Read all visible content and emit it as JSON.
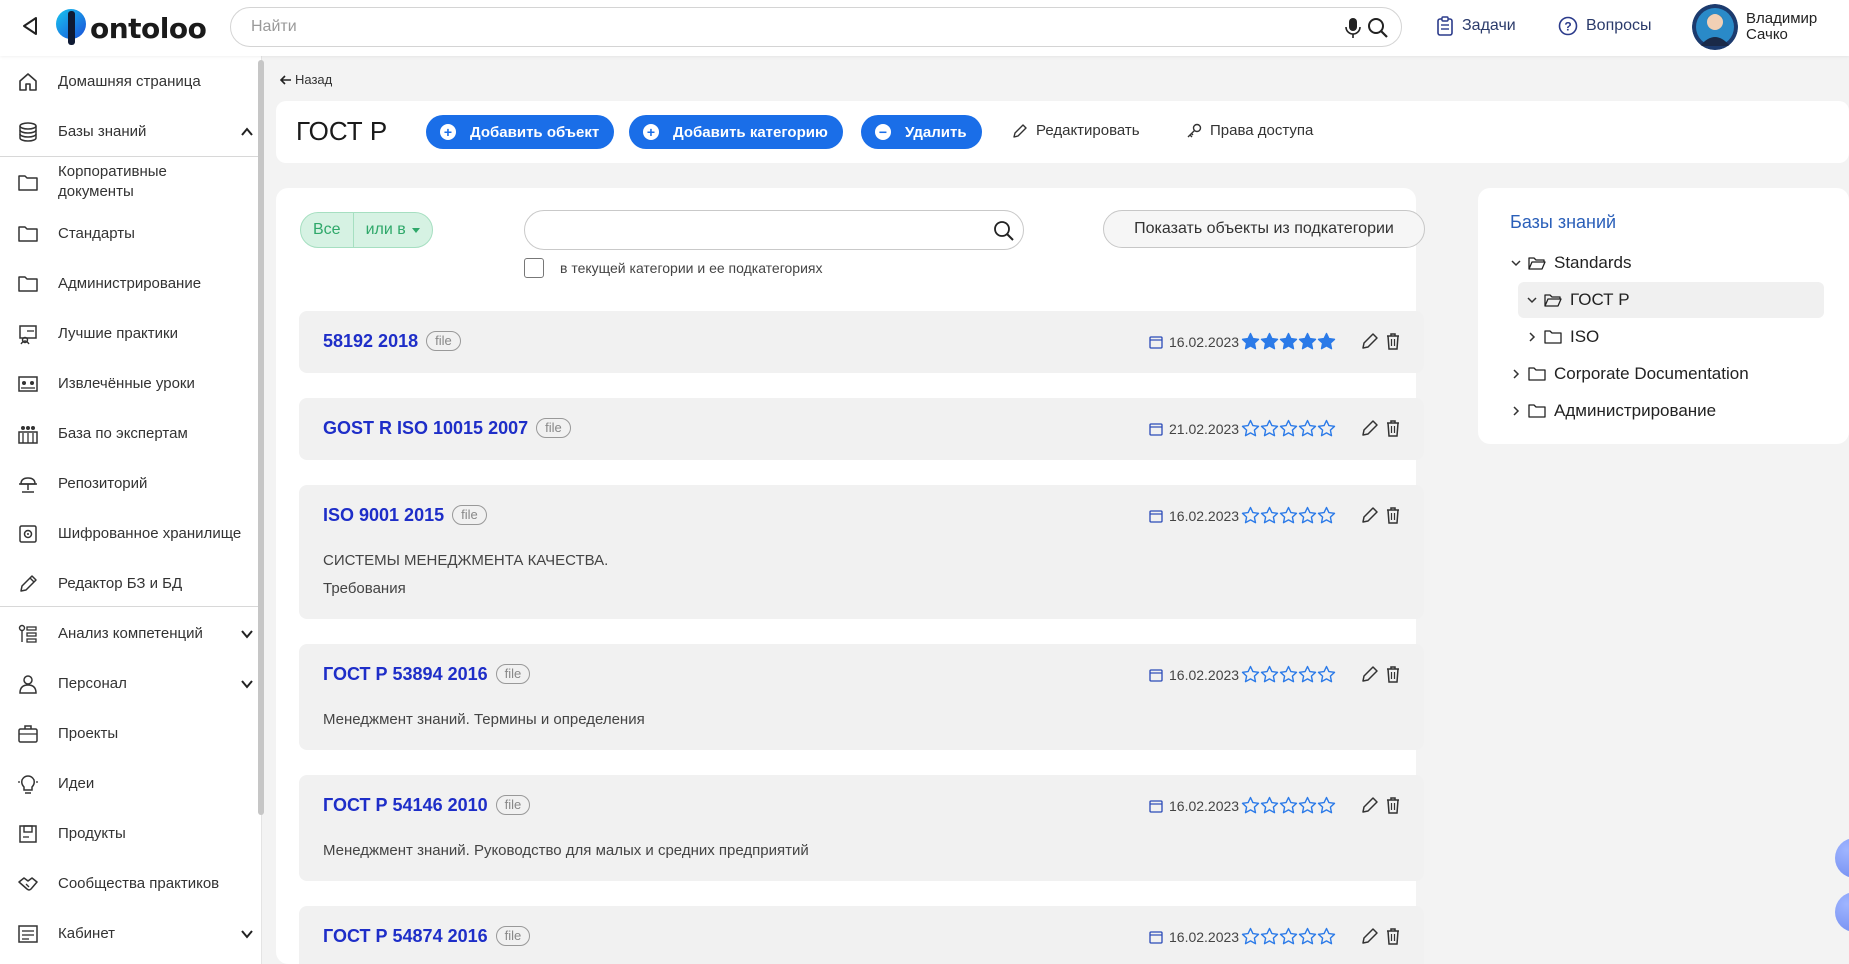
{
  "header": {
    "logo_text": "ontoloo",
    "search_placeholder": "Найти",
    "tasks_label": "Задачи",
    "questions_label": "Вопросы",
    "user_first": "Владимир",
    "user_last": "Сачко"
  },
  "sidebar": {
    "items": [
      {
        "label": "Домашняя страница",
        "icon": "home-icon"
      },
      {
        "label": "Базы знаний",
        "icon": "database-icon"
      },
      {
        "label": "Корпоративные документы",
        "icon": "folder-icon"
      },
      {
        "label": "Стандарты",
        "icon": "folder-icon"
      },
      {
        "label": "Администрирование",
        "icon": "folder-icon"
      },
      {
        "label": "Лучшие практики",
        "icon": "practices-icon"
      },
      {
        "label": "Извлечённые уроки",
        "icon": "lessons-icon"
      },
      {
        "label": "База по экспертам",
        "icon": "experts-icon"
      },
      {
        "label": "Репозиторий",
        "icon": "repository-icon"
      },
      {
        "label": "Шифрованное хранилище",
        "icon": "safe-icon"
      },
      {
        "label": "Редактор БЗ и БД",
        "icon": "pencil-icon"
      },
      {
        "label": "Анализ компетенций",
        "icon": "competence-icon"
      },
      {
        "label": "Персонал",
        "icon": "person-icon"
      },
      {
        "label": "Проекты",
        "icon": "briefcase-icon"
      },
      {
        "label": "Идеи",
        "icon": "lightbulb-icon"
      },
      {
        "label": "Продукты",
        "icon": "product-icon"
      },
      {
        "label": "Сообщества практиков",
        "icon": "handshake-icon"
      },
      {
        "label": "Кабинет",
        "icon": "cabinet-icon"
      }
    ]
  },
  "page": {
    "back_label": "Назад",
    "title": "ГОСТ Р",
    "add_object": "Добавить объект",
    "add_category": "Добавить категорию",
    "delete": "Удалить",
    "edit": "Редактировать",
    "access_rights": "Права доступа"
  },
  "filters": {
    "all": "Все",
    "or_in": "или в",
    "search_value": "",
    "show_subcategory": "Показать объекты из подкатегории",
    "checkbox_label": "в текущей категории и ее подкатегориях",
    "checkbox_checked": false
  },
  "items": [
    {
      "title": "58192 2018",
      "badge": "file",
      "date": "16.02.2023",
      "rating": 5,
      "desc1": "",
      "desc2": ""
    },
    {
      "title": "GOST R ISO 10015 2007",
      "badge": "file",
      "date": "21.02.2023",
      "rating": 0,
      "desc1": "",
      "desc2": ""
    },
    {
      "title": "ISO 9001 2015",
      "badge": "file",
      "date": "16.02.2023",
      "rating": 0,
      "desc1": "СИСТЕМЫ МЕНЕДЖМЕНТА КАЧЕСТВА.",
      "desc2": "Требования"
    },
    {
      "title": "ГОСТ Р 53894 2016",
      "badge": "file",
      "date": "16.02.2023",
      "rating": 0,
      "desc1": "Менеджмент знаний. Термины и определения",
      "desc2": ""
    },
    {
      "title": "ГОСТ Р 54146 2010",
      "badge": "file",
      "date": "16.02.2023",
      "rating": 0,
      "desc1": "Менеджмент знаний. Руководство для малых и средних предприятий",
      "desc2": ""
    },
    {
      "title": "ГОСТ Р 54874 2016",
      "badge": "file",
      "date": "16.02.2023",
      "rating": 0,
      "desc1": "",
      "desc2": ""
    }
  ],
  "tree": {
    "title": "Базы знаний",
    "nodes": [
      {
        "label": "Standards",
        "expanded": true
      },
      {
        "label": "ГОСТ Р",
        "expanded": true,
        "selected": true
      },
      {
        "label": "ISO",
        "expanded": false
      },
      {
        "label": "Corporate Documentation",
        "expanded": false
      },
      {
        "label": "Администрирование",
        "expanded": false
      }
    ]
  },
  "colors": {
    "accent": "#1a6ee8",
    "title_link": "#1e2ec8",
    "star_filled": "#2b7ae8",
    "filter_green": "#2fa86a"
  }
}
